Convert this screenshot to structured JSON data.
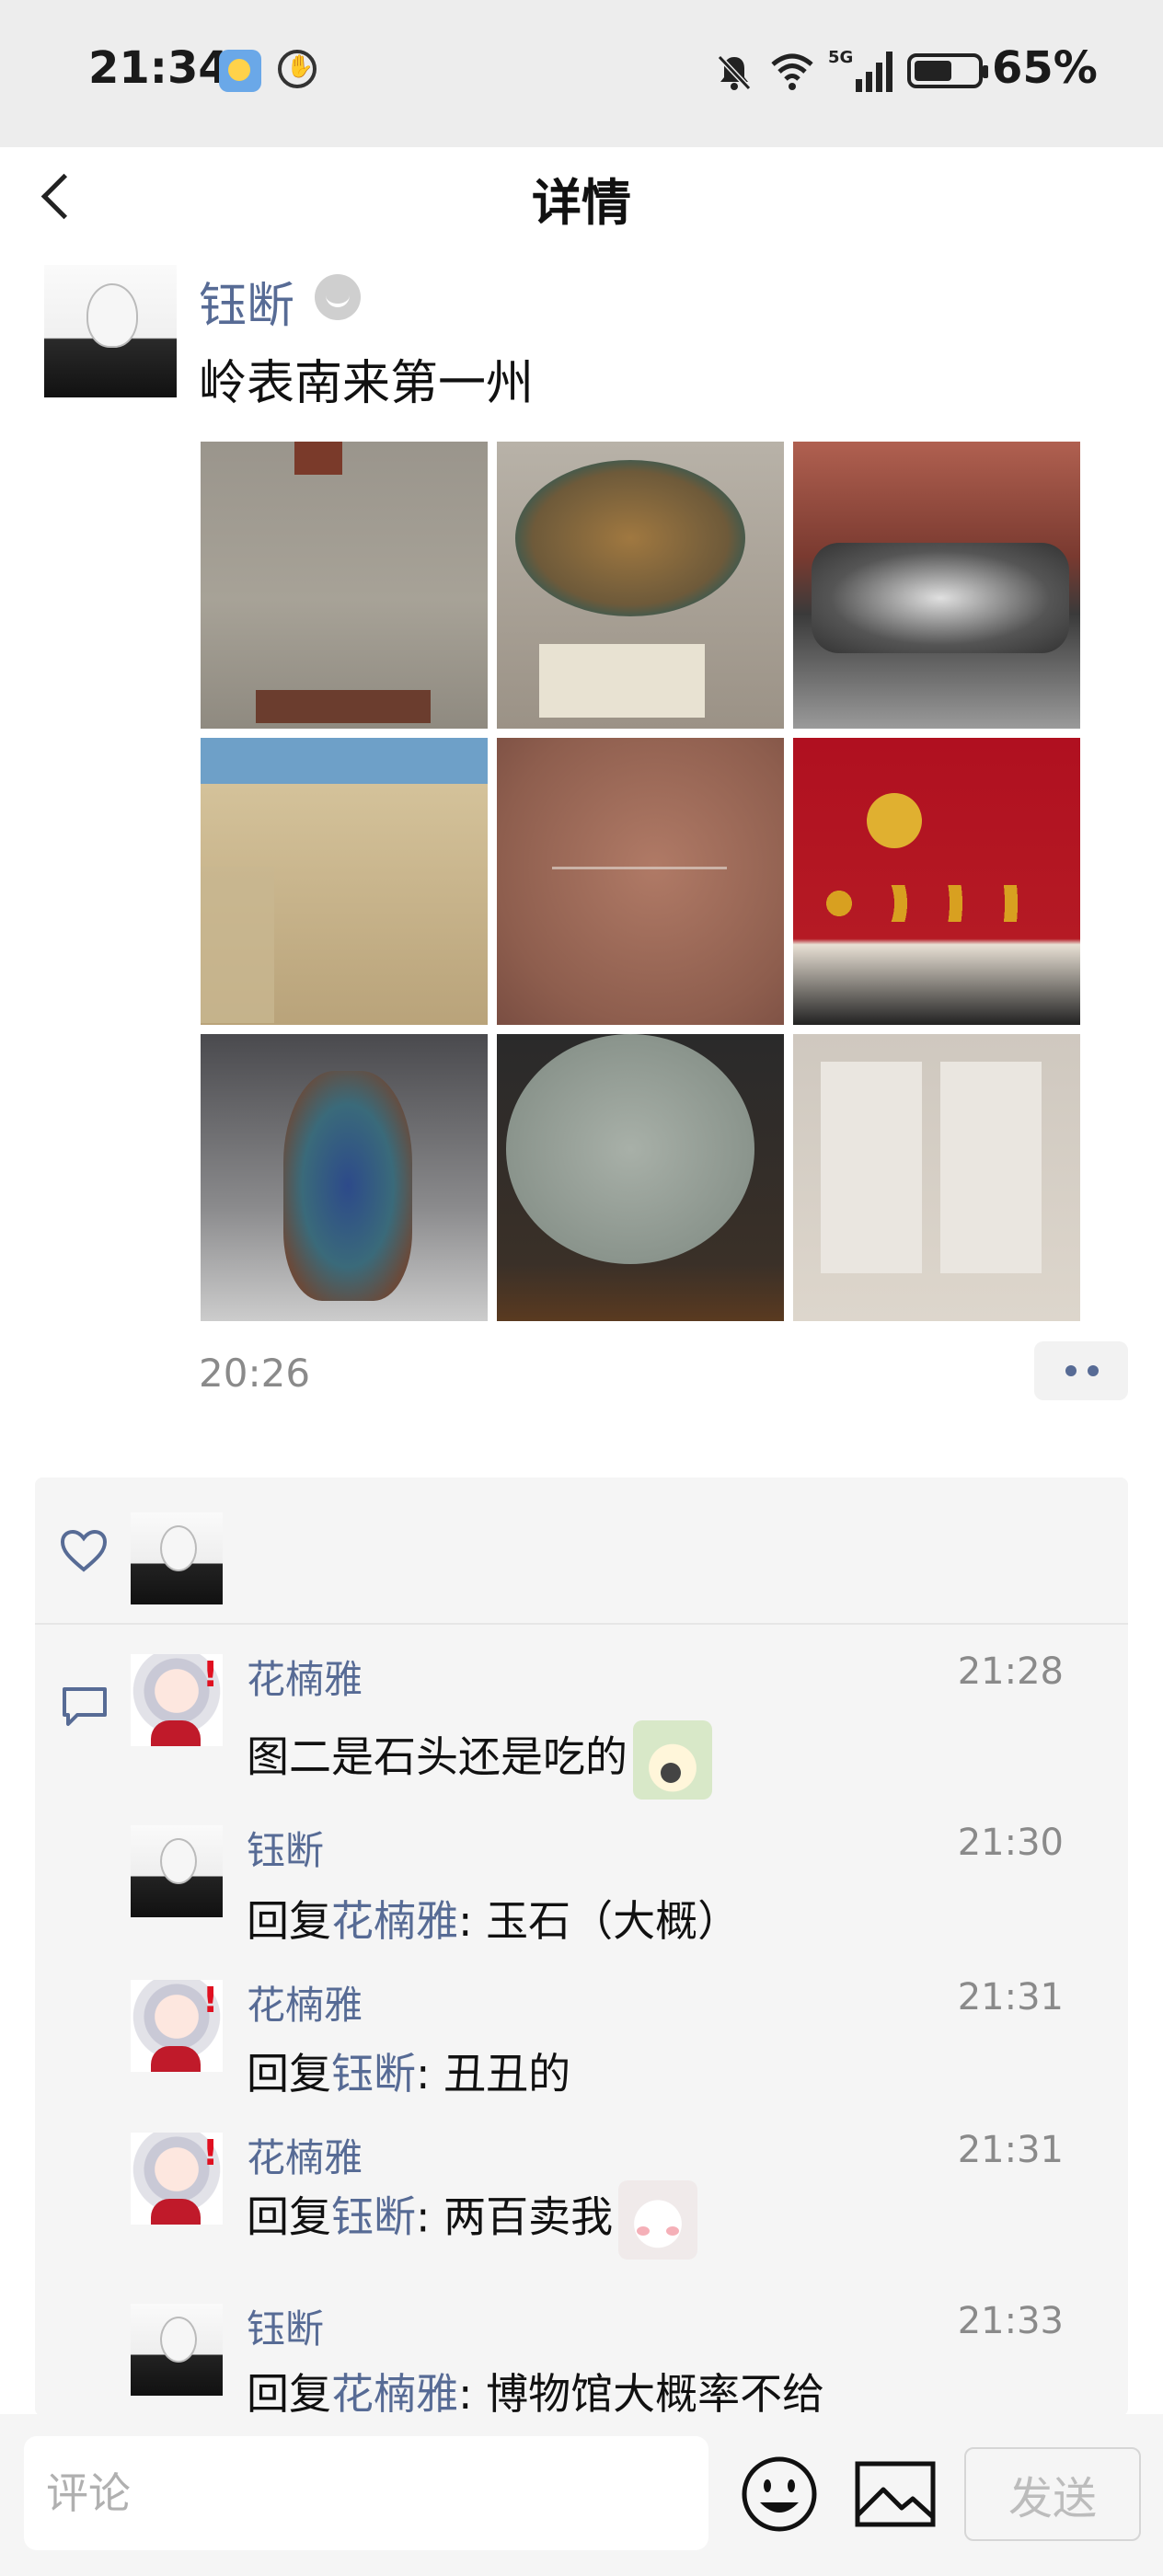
{
  "status_bar": {
    "time": "21:34",
    "battery": "65%",
    "icons": [
      "weather-icon",
      "hand-icon",
      "bell-off-icon",
      "wifi-icon",
      "signal-5g-icon",
      "battery-saver-icon"
    ]
  },
  "nav": {
    "title": "详情",
    "back_icon": "chevron-left-icon"
  },
  "post": {
    "author": "钰断",
    "text": "岭表南来第一州",
    "time": "20:26",
    "photos": [
      {
        "subject": "seal-stone-display"
      },
      {
        "subject": "jade-stone-on-stand"
      },
      {
        "subject": "carved-inkstone"
      },
      {
        "subject": "village-diorama"
      },
      {
        "subject": "carved-relief-wall"
      },
      {
        "subject": "red-medal-display"
      },
      {
        "subject": "blue-red-porcelain-vase"
      },
      {
        "subject": "round-stone-disc"
      },
      {
        "subject": "stone-tablet-rubbings"
      }
    ]
  },
  "likes": {
    "icon": "heart-outline-icon",
    "users": [
      "钰断"
    ]
  },
  "comments": [
    {
      "name": "花楠雅",
      "time": "21:28",
      "reply_prefix": "",
      "reply_to": "",
      "separator": "",
      "text": "图二是石头还是吃的",
      "sticker": "rabbit-sticker"
    },
    {
      "name": "钰断",
      "time": "21:30",
      "reply_prefix": "回复",
      "reply_to": "花楠雅",
      "separator": ": ",
      "text": "玉石（大概）",
      "sticker": ""
    },
    {
      "name": "花楠雅",
      "time": "21:31",
      "reply_prefix": "回复",
      "reply_to": "钰断",
      "separator": ": ",
      "text": "丑丑的",
      "sticker": ""
    },
    {
      "name": "花楠雅",
      "time": "21:31",
      "reply_prefix": "回复",
      "reply_to": "钰断",
      "separator": ": ",
      "text": "两百卖我",
      "sticker": "bear-sticker"
    },
    {
      "name": "钰断",
      "time": "21:33",
      "reply_prefix": "回复",
      "reply_to": "花楠雅",
      "separator": ": ",
      "text": "博物馆大概率不给",
      "sticker": ""
    }
  ],
  "input": {
    "placeholder": "评论",
    "send_label": "发送",
    "emoji_icon": "smiley-icon",
    "image_icon": "image-icon"
  },
  "colors": {
    "link": "#576b95",
    "status_bg": "#ededed",
    "panel_bg": "#f5f5f5"
  }
}
